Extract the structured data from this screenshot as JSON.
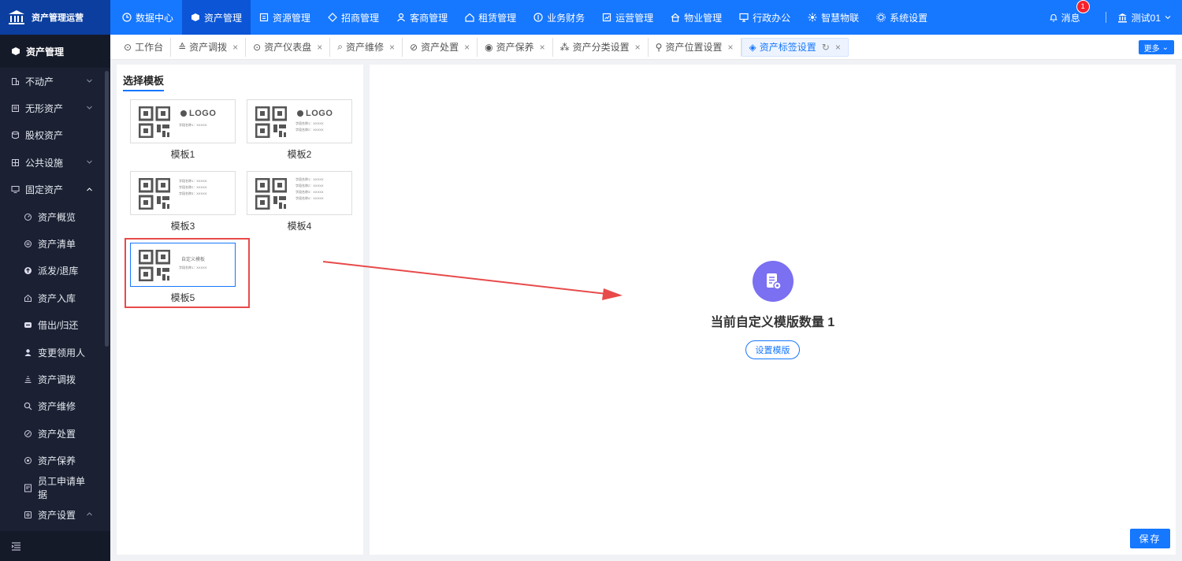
{
  "app": {
    "title": "资产管理运营"
  },
  "topnav": {
    "items": [
      {
        "label": "数据中心",
        "icon": "clock-icon"
      },
      {
        "label": "资产管理",
        "icon": "asset-icon",
        "active": true
      },
      {
        "label": "资源管理",
        "icon": "resource-icon"
      },
      {
        "label": "招商管理",
        "icon": "tag-icon"
      },
      {
        "label": "客商管理",
        "icon": "users-icon"
      },
      {
        "label": "租赁管理",
        "icon": "home-icon"
      },
      {
        "label": "业务财务",
        "icon": "coin-icon"
      },
      {
        "label": "运营管理",
        "icon": "chart-icon"
      },
      {
        "label": "物业管理",
        "icon": "building-icon"
      },
      {
        "label": "行政办公",
        "icon": "monitor-icon"
      },
      {
        "label": "智慧物联",
        "icon": "iot-icon"
      },
      {
        "label": "系统设置",
        "icon": "gear-icon"
      }
    ],
    "messages_label": "消息",
    "messages_count": "1",
    "user_label": "测试01"
  },
  "sidebar": {
    "header": "资产管理",
    "items": [
      {
        "label": "不动产",
        "level": 1,
        "chevron": "down"
      },
      {
        "label": "无形资产",
        "level": 1,
        "chevron": "down"
      },
      {
        "label": "股权资产",
        "level": 1
      },
      {
        "label": "公共设施",
        "level": 1,
        "chevron": "down"
      },
      {
        "label": "固定资产",
        "level": 1,
        "chevron": "up"
      },
      {
        "label": "资产概览",
        "level": 2
      },
      {
        "label": "资产清单",
        "level": 2
      },
      {
        "label": "派发/退库",
        "level": 2
      },
      {
        "label": "资产入库",
        "level": 2
      },
      {
        "label": "借出/归还",
        "level": 2
      },
      {
        "label": "变更领用人",
        "level": 2
      },
      {
        "label": "资产调拨",
        "level": 2
      },
      {
        "label": "资产维修",
        "level": 2
      },
      {
        "label": "资产处置",
        "level": 2
      },
      {
        "label": "资产保养",
        "level": 2
      },
      {
        "label": "员工申请单据",
        "level": 2
      },
      {
        "label": "资产设置",
        "level": 2,
        "chevron": "up"
      }
    ]
  },
  "tabs": {
    "items": [
      {
        "label": "工作台",
        "closable": false
      },
      {
        "label": "资产调拨",
        "closable": true
      },
      {
        "label": "资产仪表盘",
        "closable": true
      },
      {
        "label": "资产维修",
        "closable": true
      },
      {
        "label": "资产处置",
        "closable": true
      },
      {
        "label": "资产保养",
        "closable": true
      },
      {
        "label": "资产分类设置",
        "closable": true
      },
      {
        "label": "资产位置设置",
        "closable": true
      },
      {
        "label": "资产标签设置",
        "closable": true,
        "active": true
      }
    ],
    "more_label": "更多"
  },
  "templates": {
    "title": "选择模板",
    "logo_text": "LOGO",
    "custom_text": "自定义模板",
    "field_text": "XXXXX",
    "items": [
      {
        "label": "模板1"
      },
      {
        "label": "模板2"
      },
      {
        "label": "模板3"
      },
      {
        "label": "模板4"
      },
      {
        "label": "模板5",
        "selected": true
      }
    ]
  },
  "main": {
    "count_text": "当前自定义模版数量 1",
    "set_button": "设置模版",
    "save_button": "保存"
  },
  "colors": {
    "primary": "#1677ff",
    "sidebar_bg": "#1b2133",
    "highlight_red": "#e84a4a",
    "icon_purple": "#7b6ff2"
  }
}
